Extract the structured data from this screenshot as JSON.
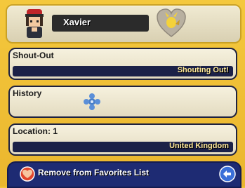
{
  "header": {
    "player_name": "Xavier"
  },
  "rows": [
    {
      "label": "Shout-Out",
      "value": "Shouting Out!"
    },
    {
      "label": "History",
      "value": ""
    },
    {
      "label": "Location: 1",
      "value": "United Kingdom"
    }
  ],
  "footer": {
    "remove_label": "Remove from Favorites List"
  },
  "colors": {
    "background": "#f2c43a",
    "value_bar": "#1b2148",
    "value_text": "#ffe999",
    "footer_bar": "#1e2b73"
  },
  "icons": [
    "trainer-avatar-icon",
    "heart-pokemon-icon",
    "history-ribbon-icon",
    "remove-favorite-icon",
    "back-arrow-icon"
  ]
}
